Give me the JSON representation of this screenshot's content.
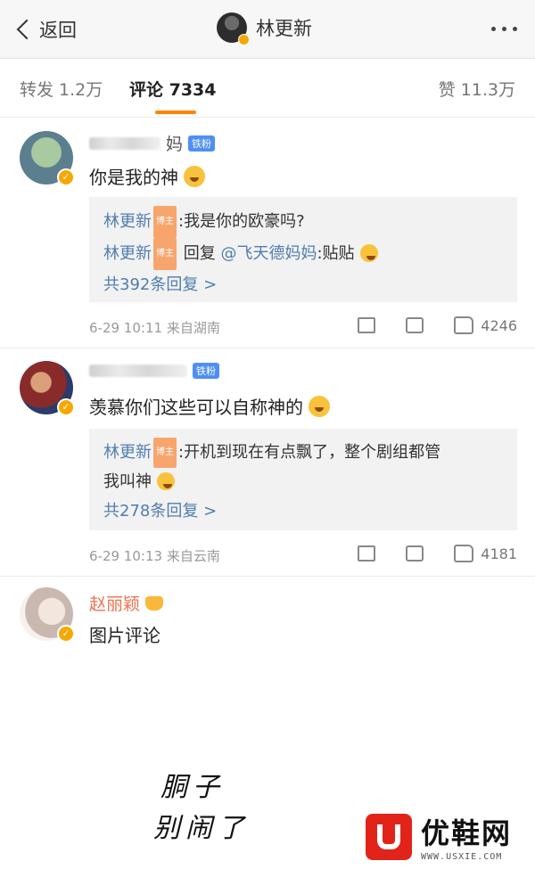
{
  "header": {
    "back_label": "返回",
    "title": "林更新"
  },
  "tabs": {
    "repost": "转发 1.2万",
    "comments": "评论 7334",
    "likes": "赞 11.3万"
  },
  "comments": [
    {
      "name_suffix": "妈",
      "fan_badge": "铁粉",
      "text": "你是我的神",
      "replies": [
        {
          "author": "林更新",
          "host_badge": "博主",
          "text": ":我是你的欧豪吗?"
        },
        {
          "author": "林更新",
          "host_badge": "博主",
          "prefix": "回复",
          "mention": "@飞天德妈妈",
          "text": ":贴贴"
        }
      ],
      "more_replies": "共392条回复 >",
      "time": "6-29 10:11",
      "source": "来自湖南",
      "like_count": "4246"
    },
    {
      "fan_badge": "铁粉",
      "text": "羡慕你们这些可以自称神的",
      "replies": [
        {
          "author": "林更新",
          "host_badge": "博主",
          "text": ":开机到现在有点飘了，整个剧组都管",
          "text2": "我叫神"
        }
      ],
      "more_replies": "共278条回复 >",
      "time": "6-29 10:13",
      "source": "来自云南",
      "like_count": "4181"
    },
    {
      "name": "赵丽颖",
      "text": "图片评论"
    }
  ],
  "handwriting": {
    "line1": "胴子",
    "line2": "别闹了"
  },
  "watermark": {
    "brand": "优鞋网",
    "url": "WWW.USXIE.COM"
  },
  "colors": {
    "accent": "#ff8200",
    "link": "#507daf",
    "vip": "#f7a800",
    "logo_red": "#e2231a"
  }
}
